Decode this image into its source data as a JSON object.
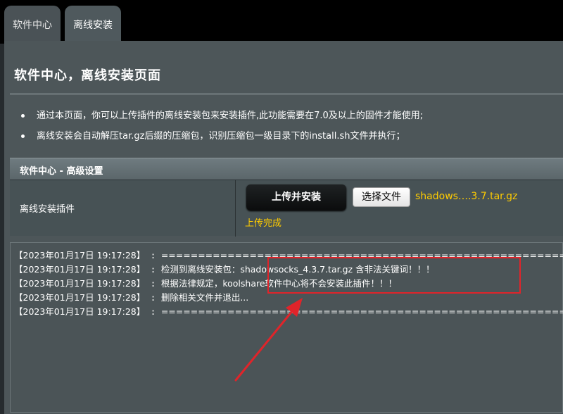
{
  "tabs": [
    {
      "label": "软件中心"
    },
    {
      "label": "离线安装"
    }
  ],
  "page": {
    "title": "软件中心，离线安装页面",
    "bullets": [
      "通过本页面，你可以上传插件的离线安装包来安装插件,此功能需要在7.0及以上的固件才能使用;",
      "离线安装会自动解压tar.gz后缀的压缩包，识别压缩包一级目录下的install.sh文件并执行；"
    ]
  },
  "section": {
    "header": "软件中心 - 高级设置",
    "row_label": "离线安装插件",
    "upload_button": "上传并安装",
    "choose_button": "选择文件",
    "file_name": "shadows….3.7.tar.gz",
    "status": "上传完成"
  },
  "log": [
    {
      "ts": "【2023年01月17日 19:17:28】",
      "sep": " : ",
      "msg": "========================================================"
    },
    {
      "ts": "【2023年01月17日 19:17:28】",
      "sep": " : ",
      "msg": "检测到离线安装包：shadowsocks_4.3.7.tar.gz 含非法关键词！！！"
    },
    {
      "ts": "【2023年01月17日 19:17:28】",
      "sep": " : ",
      "msg": "根据法律规定，koolshare软件中心将不会安装此插件！！！"
    },
    {
      "ts": "【2023年01月17日 19:17:28】",
      "sep": " : ",
      "msg": "删除相关文件并退出..."
    },
    {
      "ts": "【2023年01月17日 19:17:28】",
      "sep": " : ",
      "msg": "========================================================"
    }
  ],
  "colors": {
    "accent_yellow": "#ffcc00",
    "annotation_red": "#e0242a"
  }
}
